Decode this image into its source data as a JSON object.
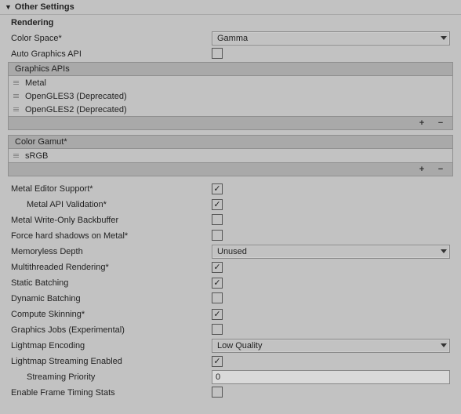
{
  "header": {
    "title": "Other Settings"
  },
  "rendering": {
    "heading": "Rendering",
    "color_space": {
      "label": "Color Space*",
      "value": "Gamma"
    },
    "auto_graphics_api": {
      "label": "Auto Graphics API",
      "checked": false
    },
    "graphics_apis": {
      "title": "Graphics APIs",
      "items": [
        "Metal",
        "OpenGLES3 (Deprecated)",
        "OpenGLES2 (Deprecated)"
      ]
    },
    "color_gamut": {
      "title": "Color Gamut*",
      "items": [
        "sRGB"
      ]
    },
    "metal_editor_support": {
      "label": "Metal Editor Support*",
      "checked": true
    },
    "metal_api_validation": {
      "label": "Metal API Validation*",
      "checked": true
    },
    "metal_write_only_backbuffer": {
      "label": "Metal Write-Only Backbuffer",
      "checked": false
    },
    "force_hard_shadows_metal": {
      "label": "Force hard shadows on Metal*",
      "checked": false
    },
    "memoryless_depth": {
      "label": "Memoryless Depth",
      "value": "Unused"
    },
    "multithreaded_rendering": {
      "label": "Multithreaded Rendering*",
      "checked": true
    },
    "static_batching": {
      "label": "Static Batching",
      "checked": true
    },
    "dynamic_batching": {
      "label": "Dynamic Batching",
      "checked": false
    },
    "compute_skinning": {
      "label": "Compute Skinning*",
      "checked": true
    },
    "graphics_jobs": {
      "label": "Graphics Jobs (Experimental)",
      "checked": false
    },
    "lightmap_encoding": {
      "label": "Lightmap Encoding",
      "value": "Low Quality"
    },
    "lightmap_streaming": {
      "label": "Lightmap Streaming Enabled",
      "checked": true
    },
    "streaming_priority": {
      "label": "Streaming Priority",
      "value": "0"
    },
    "enable_frame_timing": {
      "label": "Enable Frame Timing Stats",
      "checked": false
    }
  },
  "glyph": {
    "plus": "+",
    "minus": "−"
  }
}
